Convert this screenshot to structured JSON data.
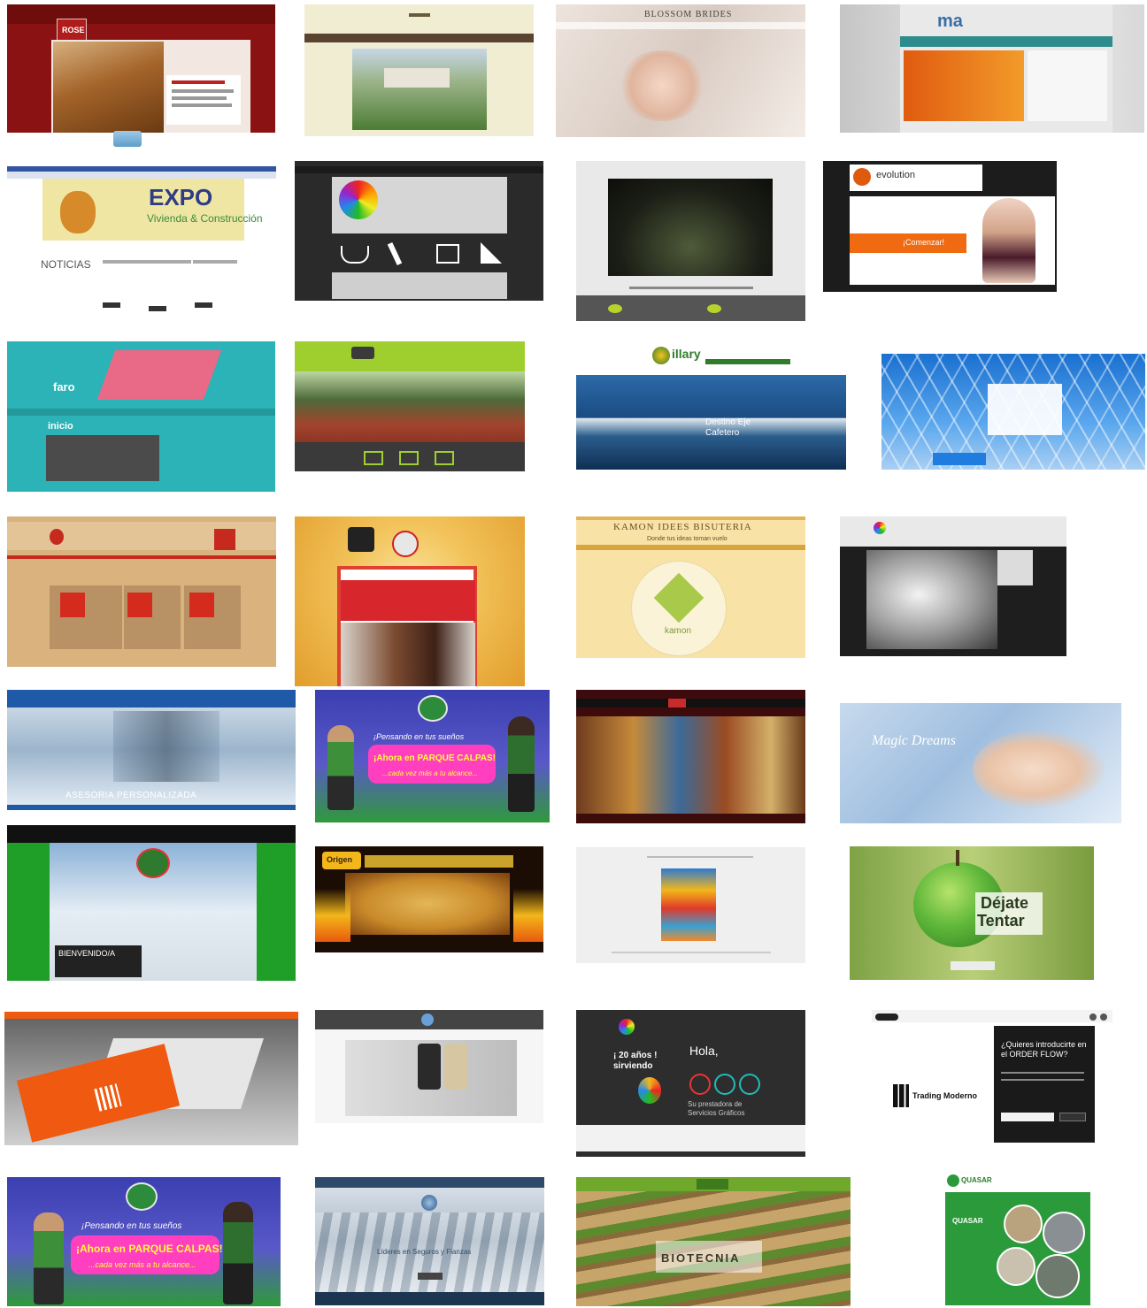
{
  "tiles": {
    "t01": {
      "badge": "ROSE"
    },
    "t03": {
      "title": "BLOSSOM BRIDES"
    },
    "t04": {
      "logo": "ma"
    },
    "t05": {
      "title_expo": "EXPO",
      "subtitle": "Vivienda & Construcción",
      "news": "NOTICIAS"
    },
    "t08": {
      "logo": "evolution",
      "cta": "¡Comenzar!"
    },
    "t09": {
      "logo": "faro",
      "heading": "inicio"
    },
    "t11": {
      "logo": "illary",
      "caption": "Destino Eje Cafetero"
    },
    "t15": {
      "title": "KAMON IDEES BISUTERIA",
      "tagline": "Donde tus ideas toman vuelo",
      "logo": "kamon"
    },
    "t17": {
      "caption": "ASESORIA PERSONALIZADA"
    },
    "t18": {
      "line1": "¡Pensando en tus sueños",
      "line2": "¡Ahora en PARQUE CALPAS!",
      "line3": "...cada vez más a tu alcance..."
    },
    "t20": {
      "script": "Magic Dreams"
    },
    "t21": {
      "welcome": "BIENVENIDO/A"
    },
    "t22": {
      "logo": "Origen"
    },
    "t24": {
      "line1": "Déjate",
      "line2": "Tentar"
    },
    "t27": {
      "years": "¡ 20 años ! sirviendo",
      "greeting": "Hola,",
      "tagline": "Su prestadora de Servicios Gráficos"
    },
    "t28": {
      "question": "¿Quieres introducirte en el ORDER FLOW?",
      "brand": "Trading Moderno"
    },
    "t29": {
      "line1": "¡Pensando en tus sueños",
      "line2": "¡Ahora en PARQUE CALPAS!",
      "line3": "...cada vez más a tu alcance..."
    },
    "t30": {
      "caption": "Líderes en Seguros y Fianzas"
    },
    "t31": {
      "title": "BIOTECNIA"
    },
    "t32": {
      "logo": "QUASAR",
      "label": "QUASAR"
    }
  }
}
